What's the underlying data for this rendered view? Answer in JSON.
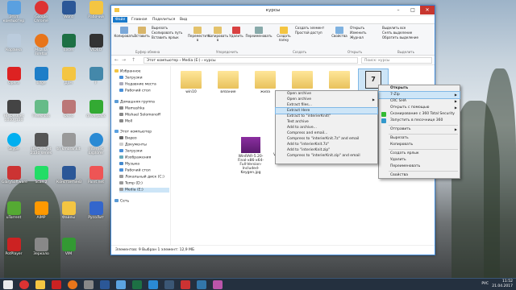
{
  "window": {
    "title": "курсы",
    "tabs": [
      "Файл",
      "Главная",
      "Поделиться",
      "Вид"
    ],
    "address_path": [
      "Этот компьютер",
      "Media (E:)",
      "курсы"
    ],
    "search_placeholder": "Поиск: курсы",
    "status": "Элементов: 9    Выбран 1 элемент: 12,9 МБ"
  },
  "ribbon": {
    "big": [
      "Копировать",
      "Вставить",
      "Переместить в",
      "Копировать в",
      "Удалить",
      "Переименовать",
      "Создать папку",
      "Свойства",
      "Выделить"
    ],
    "small": [
      "Вырезать",
      "Скопировать путь",
      "Вставить ярлык",
      "Создать элемент",
      "Простой доступ",
      "Открыть",
      "Изменить",
      "Журнал",
      "Выделить все",
      "Снять выделение",
      "Обратить выделение"
    ],
    "groups": [
      "Буфер обмена",
      "Упорядочить",
      "Создать",
      "Открыть",
      "Выделить"
    ]
  },
  "nav": {
    "favorites": "Избранное",
    "fav_items": [
      "Загрузки",
      "Недавние места",
      "Рабочий стол"
    ],
    "homegroup": "Домашняя группа",
    "hg_items": [
      "Mamashka",
      "Mishael Solomonoff",
      "Moll"
    ],
    "computer": "Этот компьютер",
    "pc_items": [
      "Видео",
      "Документы",
      "Загрузки",
      "Изображения",
      "Музыка",
      "Рабочий стол",
      "Локальный диск (C:)",
      "Temp (D:)",
      "Media (E:)"
    ],
    "network": "Сеть"
  },
  "files": [
    {
      "name": "win10",
      "kind": "folder"
    },
    {
      "name": "вязание",
      "kind": "folder"
    },
    {
      "name": "жиза",
      "kind": "folder"
    },
    {
      "name": "",
      "kind": "folder"
    },
    {
      "name": "",
      "kind": "folder"
    },
    {
      "name": "",
      "kind": "7z"
    },
    {
      "name": "WinRAR-5.20-Final-x86-x64-Full-Version-Included-Keygen.jpg",
      "kind": "rar"
    },
    {
      "name": "Vyshivka_gladju_Cvety_i_plody.rar",
      "kind": "rar2"
    }
  ],
  "context_menu": [
    "Открыть",
    "7-Zip",
    "CRC SHA",
    "Открыть с помощью",
    "Сканирование с 360 Total Security",
    "Запустить в песочнице 360",
    "Отправить",
    "Вырезать",
    "Копировать",
    "Создать ярлык",
    "Удалить",
    "Переименовать",
    "Свойства"
  ],
  "submenu_7zip": [
    "Open archive",
    "Open archive",
    "Extract files...",
    "Extract Here",
    "Extract to \"interierKnit\\\"",
    "Test archive",
    "Add to archive...",
    "Compress and email...",
    "Compress to \"interierKnit.7z\" and email",
    "Add to \"interierKnit.7z\"",
    "Add to \"interierKnit.zip\"",
    "Compress to \"interierKnit.zip\" and email"
  ],
  "desktop_icons": [
    "Этот компьютер",
    "Корзина",
    "Opera",
    "Google Chrome",
    "Mozilla Firefox",
    "Edge",
    "Word",
    "Excel",
    "Дом",
    "Рабочий",
    "VIDEO",
    "F",
    "HP Deskjet 1000 J110",
    "Freeshots",
    "Фото",
    "driverpack",
    "Skype",
    "HP Deskjet 2130 series",
    "tri kmorar.kit",
    "Internet Explorer",
    "GlarySoftware",
    "Scan 2",
    "КонстантинВ",
    "Paint.net",
    "",
    "uTorrent",
    "AIMP",
    "Файлы",
    "РусоЛит",
    "PotPlayer",
    "Зеркало",
    "VIM"
  ],
  "tray": {
    "time": "11:52",
    "date": "21.04.2017",
    "lang": "РУС"
  }
}
